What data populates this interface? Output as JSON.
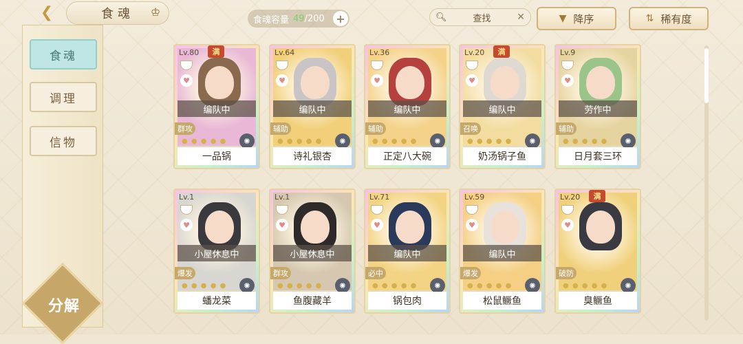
{
  "header": {
    "back_icon": "chevron-left-icon",
    "title": "食魂",
    "capacity_label": "食魂容量",
    "capacity_current": "49",
    "capacity_max": "/200",
    "search_placeholder": "查找",
    "sort_label": "降序",
    "rarity_label": "稀有度"
  },
  "sidebar": {
    "items": [
      {
        "label": "食魂",
        "active": true
      },
      {
        "label": "调理",
        "active": false
      },
      {
        "label": "信物",
        "active": false
      }
    ],
    "decompose_label": "分解"
  },
  "cards": [
    {
      "level": "Lv.80",
      "max": "满",
      "status": "编队中",
      "role": "群攻",
      "name": "一品锅",
      "hair": "#8a6a4e",
      "art": "#e9b8d6"
    },
    {
      "level": "Lv.64",
      "max": "",
      "status": "编队中",
      "role": "辅助",
      "name": "诗礼银杏",
      "hair": "#c9c4c6",
      "art": "#f2d07a"
    },
    {
      "level": "Lv.36",
      "max": "",
      "status": "编队中",
      "role": "辅助",
      "name": "正定八大碗",
      "hair": "#b5403e",
      "art": "#f4d28a"
    },
    {
      "level": "Lv.20",
      "max": "满",
      "status": "编队中",
      "role": "召唤",
      "name": "奶汤锅子鱼",
      "hair": "#dedad2",
      "art": "#f2dca0"
    },
    {
      "level": "Lv.9",
      "max": "",
      "status": "劳作中",
      "role": "辅助",
      "name": "日月套三环",
      "hair": "#9ac48a",
      "art": "#e6d4a0"
    },
    {
      "level": "Lv.1",
      "max": "",
      "status": "小屋休息中",
      "role": "爆发",
      "name": "蟠龙菜",
      "hair": "#3a3a3e",
      "art": "#d8d6d0"
    },
    {
      "level": "Lv.1",
      "max": "",
      "status": "小屋休息中",
      "role": "群攻",
      "name": "鱼腹藏羊",
      "hair": "#2e2a2a",
      "art": "#d6c8b0"
    },
    {
      "level": "Lv.71",
      "max": "",
      "status": "编队中",
      "role": "必中",
      "name": "锅包肉",
      "hair": "#2a3a5a",
      "art": "#f3d484"
    },
    {
      "level": "Lv.59",
      "max": "",
      "status": "编队中",
      "role": "爆发",
      "name": "松鼠鳜鱼",
      "hair": "#e8e2dc",
      "art": "#f4cf84"
    },
    {
      "level": "Lv.20",
      "max": "满",
      "status": "",
      "role": "破防",
      "name": "臭鳜鱼",
      "hair": "#3a3a42",
      "art": "#f0d07a"
    }
  ]
}
